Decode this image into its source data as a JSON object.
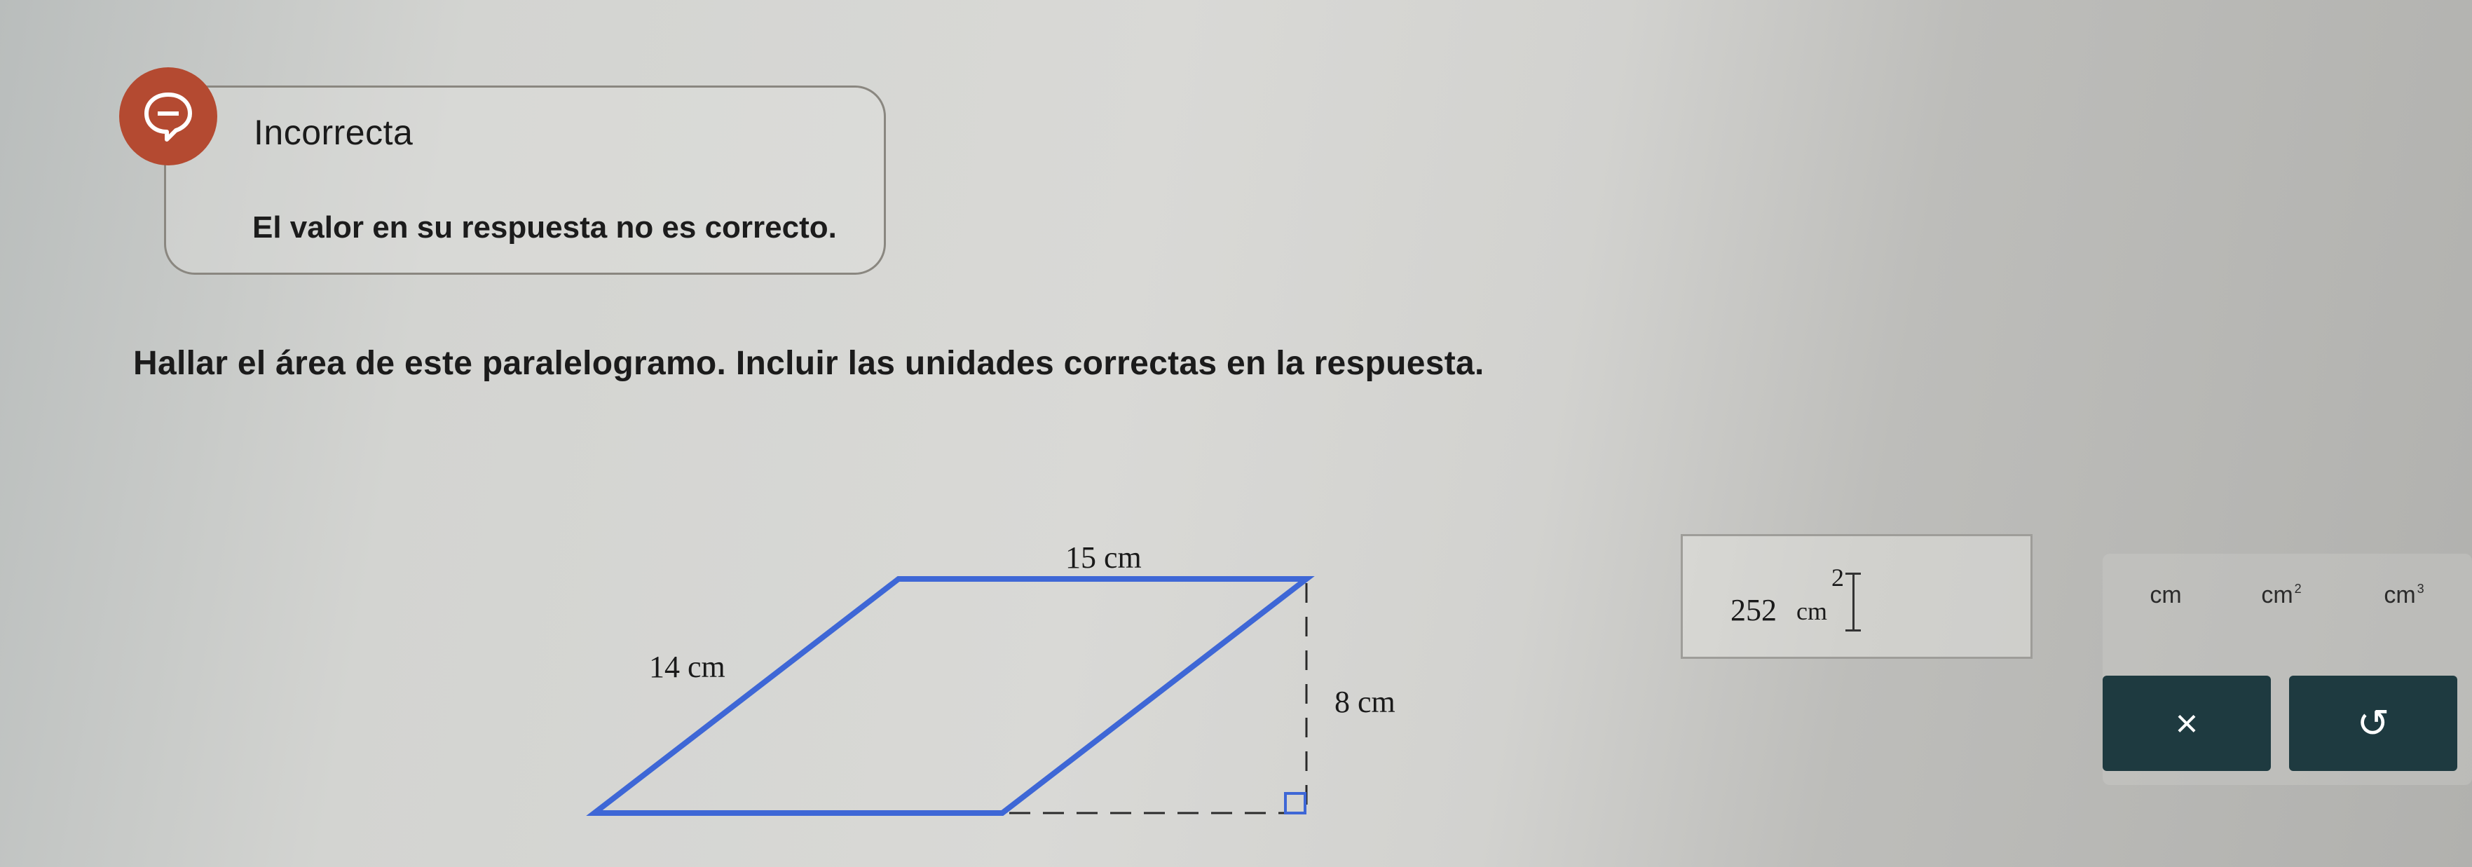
{
  "feedback": {
    "title": "Incorrecta",
    "message": "El valor en su respuesta no es correcto.",
    "icon": "speech-bubble-minus-icon",
    "icon_color": "#b44a31"
  },
  "question": {
    "text": "Hallar el área de este paralelogramo. Incluir las unidades correctas en la respuesta."
  },
  "figure": {
    "base_label": "15 cm",
    "side_label": "14 cm",
    "height_label": "8 cm",
    "outline_color": "#3e67d6"
  },
  "answer": {
    "value": "252",
    "unit": "cm",
    "superscript": "2"
  },
  "keypad": {
    "unit_cm": "cm",
    "unit_cm2_base": "cm",
    "unit_cm2_sup": "2",
    "unit_cm3_base": "cm",
    "unit_cm3_sup": "3",
    "clear_symbol": "×",
    "undo_symbol": "↺",
    "button_color": "#1e3a40"
  }
}
